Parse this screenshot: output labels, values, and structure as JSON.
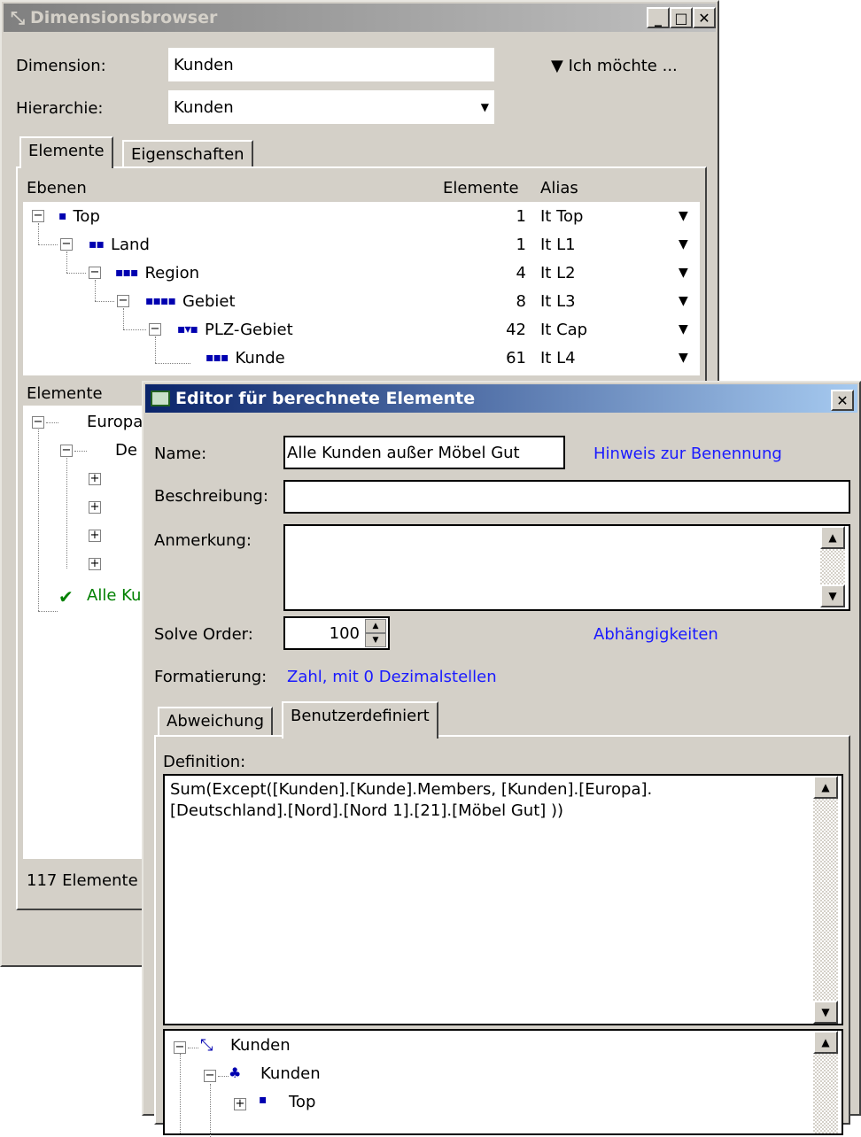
{
  "dimbrowser": {
    "title": "Dimensionsbrowser",
    "dimension_label": "Dimension:",
    "dimension_value": "Kunden",
    "hierarchy_label": "Hierarchie:",
    "hierarchy_value": "Kunden",
    "menu_label": "▼ Ich möchte ...",
    "tabs": [
      "Elemente",
      "Eigenschaften"
    ],
    "levels_header": {
      "name": "Ebenen",
      "count": "Elemente",
      "alias": "Alias"
    },
    "levels": [
      {
        "name": "Top",
        "marker": "▪",
        "count": "1",
        "alias": "It Top"
      },
      {
        "name": "Land",
        "marker": "▪▪",
        "count": "1",
        "alias": "It L1"
      },
      {
        "name": "Region",
        "marker": "▪▪▪",
        "count": "4",
        "alias": "It L2"
      },
      {
        "name": "Gebiet",
        "marker": "▪▪▪▪",
        "count": "8",
        "alias": "It L3"
      },
      {
        "name": "PLZ-Gebiet",
        "marker": "▪▾▪",
        "count": "42",
        "alias": "It Cap"
      },
      {
        "name": "Kunde",
        "marker": "▪▪▪",
        "count": "61",
        "alias": "It L4"
      }
    ],
    "elements_header": "Elemente",
    "elements": [
      {
        "text": "Europa"
      },
      {
        "text": "De"
      },
      {
        "text": "Alle Ku"
      }
    ],
    "status": "117 Elemente"
  },
  "editor": {
    "title": "Editor für berechnete Elemente",
    "name_label": "Name:",
    "name_value": "Alle Kunden außer Möbel Gut",
    "naming_hint": "Hinweis zur Benennung",
    "description_label": "Beschreibung:",
    "description_value": "",
    "note_label": "Anmerkung:",
    "note_value": "",
    "solve_order_label": "Solve Order:",
    "solve_order_value": "100",
    "dependencies_link": "Abhängigkeiten",
    "formatting_label": "Formatierung:",
    "formatting_value": "Zahl, mit 0 Dezimalstellen",
    "tabs": [
      "Abweichung",
      "Benutzerdefiniert"
    ],
    "definition_label": "Definition:",
    "definition_line1": "Sum(Except([Kunden].[Kunde].Members, [Kunden].[Europa].",
    "definition_line2": "[Deutschland].[Nord].[Nord 1].[21].[Möbel Gut] ))",
    "tree": [
      {
        "text": "Kunden"
      },
      {
        "text": "Kunden"
      },
      {
        "text": "Top"
      }
    ]
  },
  "colors": {
    "link": "#1a1aff",
    "level_marker": "#0000b0",
    "check": "#008000",
    "active_title": "#0a246a"
  }
}
